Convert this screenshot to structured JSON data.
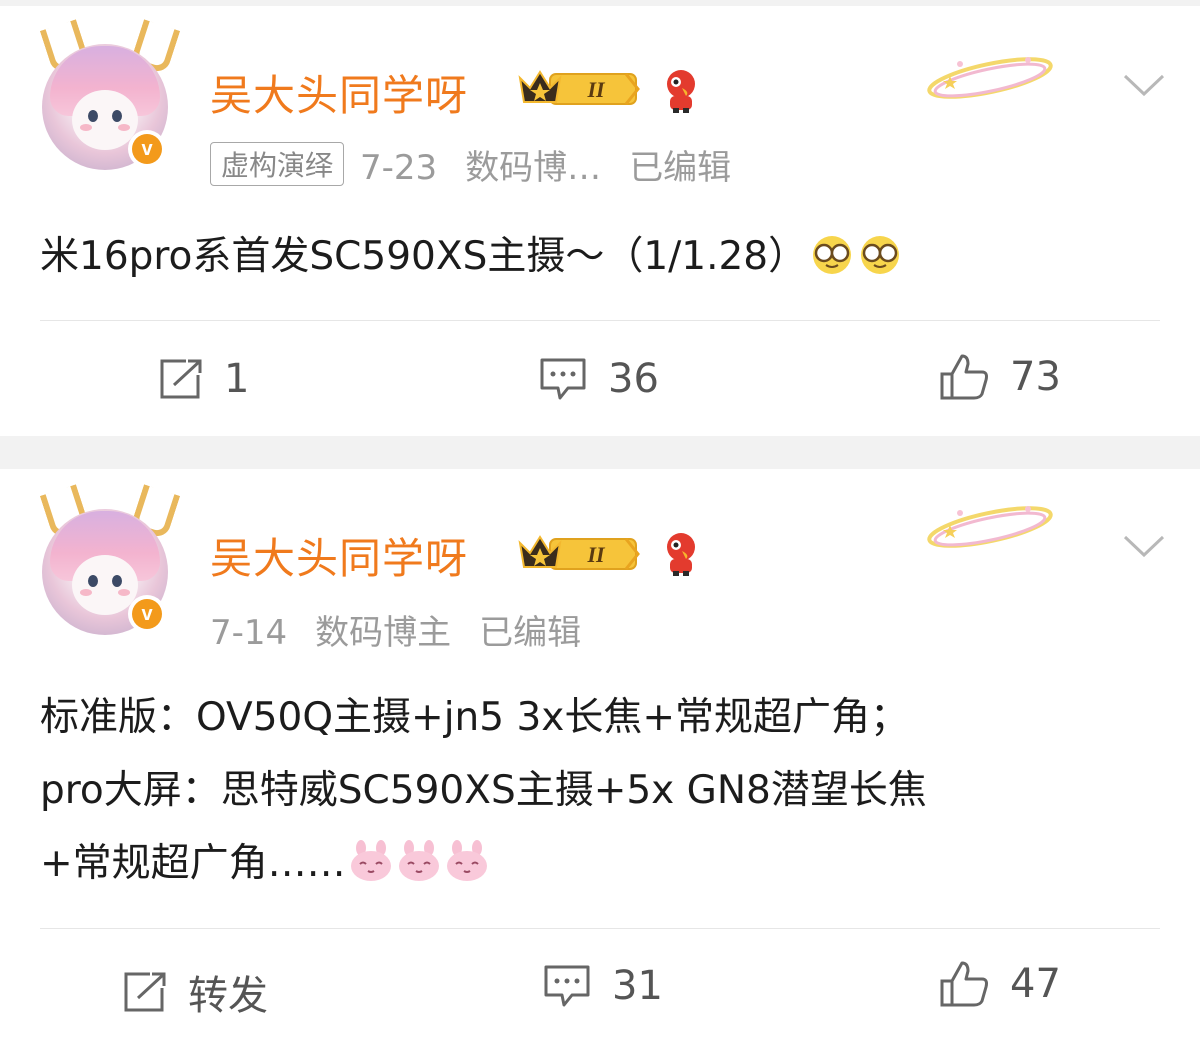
{
  "posts": [
    {
      "username": "吴大头同学呀",
      "level_badge": "II",
      "tag": "虚构演绎",
      "date": "7-23",
      "category": "数码博…",
      "edited": "已编辑",
      "text": "米16pro系首发SC590XS主摄～（1/1.28）",
      "text_emojis": [
        "glasses-face",
        "glasses-face"
      ],
      "actions": {
        "repost": "1",
        "comment": "36",
        "like": "73"
      }
    },
    {
      "username": "吴大头同学呀",
      "level_badge": "II",
      "date": "7-14",
      "category": "数码博主",
      "edited": "已编辑",
      "lines": [
        "标准版：OV50Q主摄+jn5 3x长焦+常规超广角；",
        "pro大屏：思特威SC590XS主摄+5x GN8潜望长焦",
        "+常规超广角……"
      ],
      "text_emojis": [
        "bunny-face",
        "bunny-face",
        "bunny-face"
      ],
      "actions": {
        "repost": "转发",
        "comment": "31",
        "like": "47"
      }
    }
  ],
  "colors": {
    "username": "#f07a1d",
    "meta": "#9b9b9b",
    "text": "#1c1c1c",
    "background": "#f2f2f2"
  }
}
